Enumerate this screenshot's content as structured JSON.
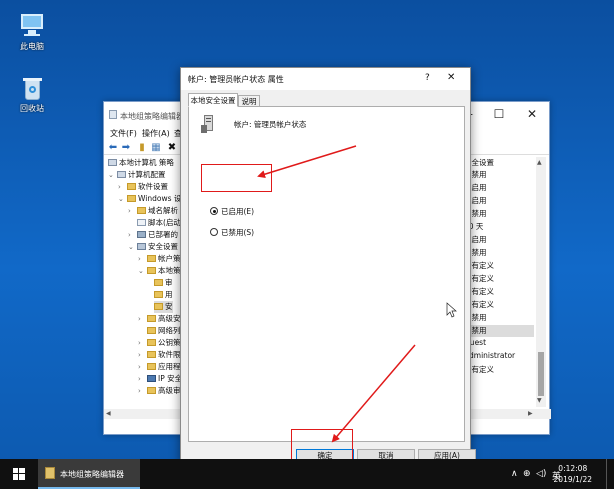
{
  "desktop": {
    "icons": [
      {
        "label": "此电脑",
        "icon": "computer-icon"
      },
      {
        "label": "回收站",
        "icon": "recycle-bin-icon"
      }
    ]
  },
  "gp_editor": {
    "title": "本地组策略编辑器",
    "controls": {
      "minimize": "—",
      "maximize": "☐",
      "close": "✕"
    },
    "menu": [
      "文件(F)",
      "操作(A)",
      "查"
    ],
    "tree": [
      {
        "label": "本地计算机 策略",
        "exp": ""
      },
      {
        "label": "计算机配置",
        "exp": "⌄"
      },
      {
        "label": "软件设置",
        "exp": "›"
      },
      {
        "label": "Windows 设",
        "exp": "⌄"
      },
      {
        "label": "域名解析",
        "exp": "›"
      },
      {
        "label": "脚本(启动",
        "exp": ""
      },
      {
        "label": "已部署的",
        "exp": "›"
      },
      {
        "label": "安全设置",
        "exp": "⌄"
      },
      {
        "label": "帐户策",
        "exp": "›"
      },
      {
        "label": "本地策",
        "exp": "⌄"
      },
      {
        "label": "审",
        "exp": ""
      },
      {
        "label": "用",
        "exp": ""
      },
      {
        "label": "安",
        "exp": ""
      },
      {
        "label": "高级安",
        "exp": "›"
      },
      {
        "label": "网络列",
        "exp": ""
      },
      {
        "label": "公钥策",
        "exp": "›"
      },
      {
        "label": "软件限",
        "exp": "›"
      },
      {
        "label": "应用程",
        "exp": "›"
      },
      {
        "label": "IP 安全",
        "exp": "›"
      },
      {
        "label": "高级审",
        "exp": "›"
      }
    ],
    "policy_header": "安全设置",
    "policy_values": [
      "已禁用",
      "已启用",
      "已启用",
      "已禁用",
      "30 天",
      "已启用",
      "已禁用",
      "没有定义",
      "没有定义",
      "没有定义",
      "没有定义",
      "已禁用",
      "已禁用",
      "Guest",
      "Administrator",
      "没有定义"
    ],
    "selected_policy_index": 12
  },
  "dialog": {
    "title": "帐户: 管理员帐户状态 属性",
    "help": "?",
    "close": "✕",
    "tabs": [
      "本地安全设置",
      "说明"
    ],
    "policy_name": "帐户: 管理员帐户状态",
    "options": [
      {
        "label": "已启用(E)",
        "checked": true
      },
      {
        "label": "已禁用(S)",
        "checked": false
      }
    ],
    "buttons": {
      "ok": "确定",
      "cancel": "取消",
      "apply": "应用(A)"
    }
  },
  "taskbar": {
    "app_label": "本地组策略编辑器",
    "tray_chevron": "∧",
    "network": "⊕",
    "volume": "◁)",
    "ime": "英",
    "time": "0:12:08",
    "date": "2019/1/22"
  },
  "colors": {
    "annotation": "#e01a1a",
    "desktop": "#1169c8",
    "accent": "#0078d7"
  }
}
